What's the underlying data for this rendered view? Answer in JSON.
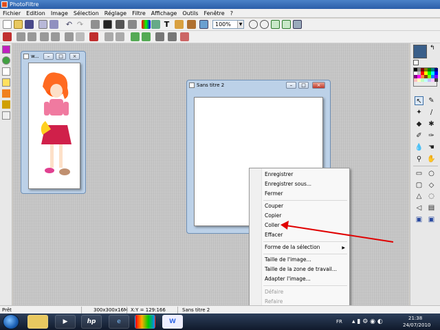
{
  "app": {
    "title": "PhotoFiltre"
  },
  "menubar": [
    "Fichier",
    "Edition",
    "Image",
    "Sélection",
    "Réglage",
    "Filtre",
    "Affichage",
    "Outils",
    "Fenêtre",
    "?"
  ],
  "toolbar": {
    "zoom_value": "100%",
    "text_tool": "T"
  },
  "windows": {
    "small": {
      "title": "w..."
    },
    "main": {
      "title": "Sans titre 2"
    }
  },
  "context_menu": {
    "items": [
      {
        "label": "Enregistrer"
      },
      {
        "label": "Enregistrer sous..."
      },
      {
        "label": "Fermer"
      },
      {
        "label": "Couper"
      },
      {
        "label": "Copier"
      },
      {
        "label": "Coller"
      },
      {
        "label": "Effacer"
      },
      {
        "label": "Forme de la sélection"
      },
      {
        "label": "Taille de l'image..."
      },
      {
        "label": "Taille de la zone de travail..."
      },
      {
        "label": "Adapter l'image..."
      },
      {
        "label": "Défaire"
      },
      {
        "label": "Refaire"
      }
    ]
  },
  "statusbar": {
    "state": "Prêt",
    "dimensions": "300x300x16M",
    "coords": "X:Y = 129:166",
    "doc": "Sans titre 2"
  },
  "taskbar": {
    "lang": "FR",
    "time": "21:38",
    "date": "24/07/2010",
    "hp_label": "hp",
    "word_label": "W"
  },
  "colors": {
    "foreground": "#3a5f8a",
    "arrow": "#e00000",
    "title_bar": "#2a5ea8"
  }
}
